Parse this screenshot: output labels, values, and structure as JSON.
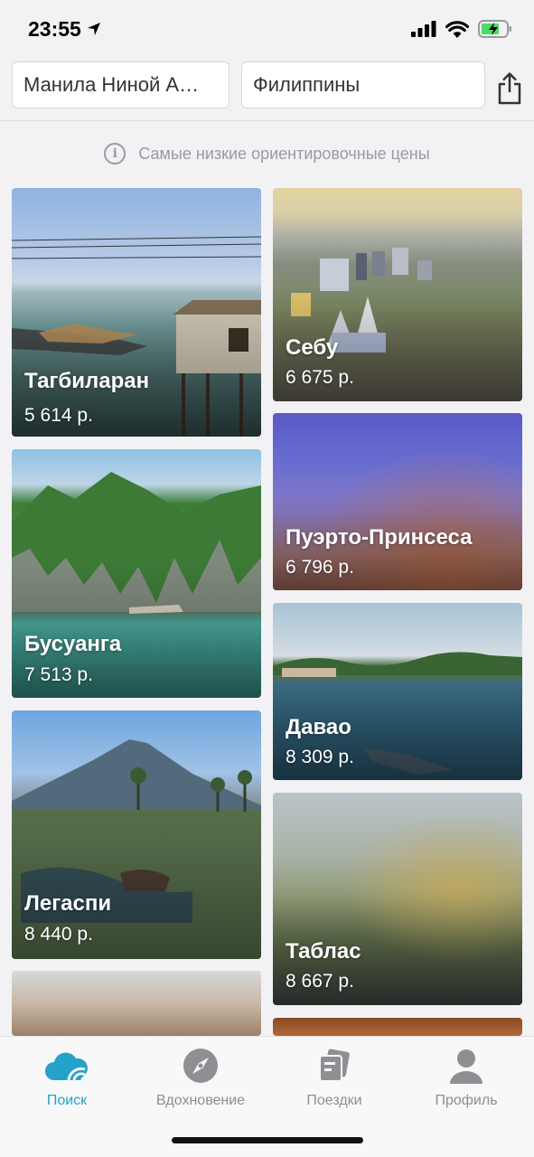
{
  "status_bar": {
    "time": "23:55"
  },
  "search": {
    "origin": "Манила Ниной А…",
    "destination": "Филиппины"
  },
  "info_note": "Самые низкие ориентировочные цены",
  "destinations": [
    {
      "city": "Тагбиларан",
      "price": "5 614 р."
    },
    {
      "city": "Себу",
      "price": "6 675 р."
    },
    {
      "city": "Пуэрто-Принсеса",
      "price": "6 796 р."
    },
    {
      "city": "Бусуанга",
      "price": "7 513 р."
    },
    {
      "city": "Давао",
      "price": "8 309 р."
    },
    {
      "city": "Легаспи",
      "price": "8 440 р."
    },
    {
      "city": "Таблас",
      "price": "8 667 р."
    }
  ],
  "tabs": [
    {
      "label": "Поиск",
      "icon": "cloud-wifi-icon",
      "active": true
    },
    {
      "label": "Вдохновение",
      "icon": "compass-icon",
      "active": false
    },
    {
      "label": "Поездки",
      "icon": "tickets-icon",
      "active": false
    },
    {
      "label": "Профиль",
      "icon": "user-icon",
      "active": false
    }
  ],
  "colors": {
    "accent": "#24a2c7",
    "inactive": "#8e8e93",
    "background": "#f2f2f4",
    "battery": "#4cd964"
  }
}
